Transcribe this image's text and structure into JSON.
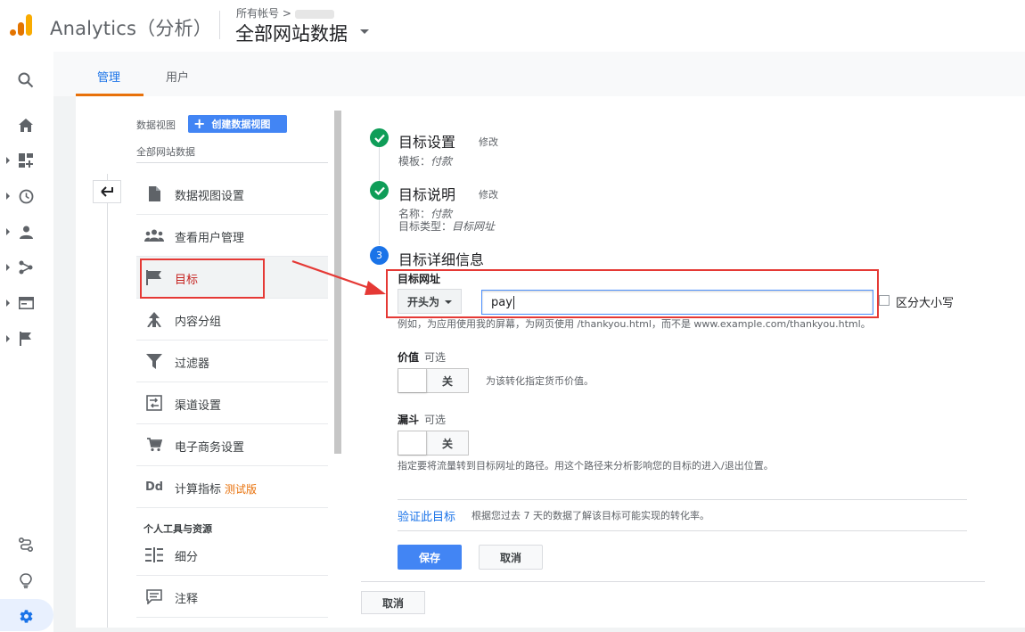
{
  "header": {
    "app_title": "Analytics（分析）",
    "account_path": "所有帐号 >",
    "view_name": "全部网站数据"
  },
  "tabs": [
    {
      "label": "管理",
      "active": true
    },
    {
      "label": "用户",
      "active": false
    }
  ],
  "nav": {
    "view_label": "数据视图",
    "create_view_label": "创建数据视图",
    "all_site_label": "全部网站数据",
    "items": [
      {
        "label": "数据视图设置",
        "icon": "document-icon"
      },
      {
        "label": "查看用户管理",
        "icon": "people-icon"
      },
      {
        "label": "目标",
        "icon": "flag-icon",
        "active": true
      },
      {
        "label": "内容分组",
        "icon": "content-grouping-icon"
      },
      {
        "label": "过滤器",
        "icon": "filter-icon"
      },
      {
        "label": "渠道设置",
        "icon": "channel-icon"
      },
      {
        "label": "电子商务设置",
        "icon": "cart-icon"
      },
      {
        "label": "计算指标",
        "icon": "dd-icon",
        "badge": "测试版"
      }
    ],
    "tools_header": "个人工具与资源",
    "tools_items": [
      {
        "label": "细分",
        "icon": "segments-icon"
      },
      {
        "label": "注释",
        "icon": "annotation-icon"
      }
    ]
  },
  "steps": {
    "step1": {
      "title": "目标设置",
      "edit": "修改",
      "sub": "模板：",
      "sub_value": "付款"
    },
    "step2": {
      "title": "目标说明",
      "edit": "修改",
      "sub_name": "名称：",
      "sub_name_value": "付款",
      "sub_type": "目标类型：",
      "sub_type_value": "目标网址"
    },
    "step3": {
      "number": "3",
      "title": "目标详细信息"
    }
  },
  "goal_details": {
    "url_label": "目标网址",
    "match_type": "开头为",
    "url_value": "pay",
    "case_sensitive_label": "区分大小写",
    "example_text": "例如，为应用使用我的屏幕，为网页使用 /thankyou.html，而不是 www.example.com/thankyou.html。",
    "value_label": "价值",
    "value_optional": "可选",
    "value_toggle": "关",
    "value_desc": "为该转化指定货币价值。",
    "funnel_label": "漏斗",
    "funnel_optional": "可选",
    "funnel_toggle": "关",
    "funnel_desc": "指定要将流量转到目标网址的路径。用这个路径来分析影响您的目标的进入/退出位置。",
    "verify_link": "验证此目标",
    "verify_desc": "根据您过去 7 天的数据了解该目标可能实现的转化率。",
    "save": "保存",
    "cancel": "取消",
    "cancel_bottom": "取消"
  },
  "colors": {
    "accent_blue": "#1a73e8",
    "button_blue": "#4285f4",
    "highlight_red": "#e53935",
    "check_green": "#0f9d58",
    "tab_orange": "#e8710a"
  }
}
